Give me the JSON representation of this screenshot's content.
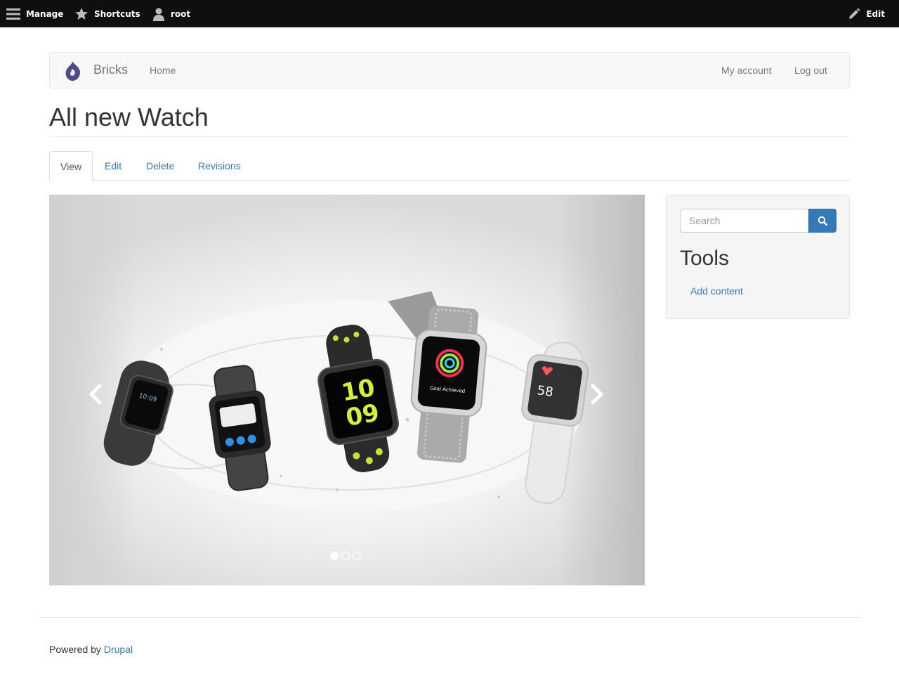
{
  "toolbar": {
    "manage_label": "Manage",
    "shortcuts_label": "Shortcuts",
    "user_label": "root",
    "edit_label": "Edit"
  },
  "navbar": {
    "brand": "Bricks",
    "home": "Home",
    "my_account": "My account",
    "log_out": "Log out"
  },
  "page": {
    "title": "All new Watch"
  },
  "tabs": [
    {
      "label": "View",
      "active": true
    },
    {
      "label": "Edit",
      "active": false
    },
    {
      "label": "Delete",
      "active": false
    },
    {
      "label": "Revisions",
      "active": false
    }
  ],
  "carousel": {
    "slide_count": 3,
    "active_slide": 1,
    "watch_texts": {
      "w1_time": "10:09",
      "w3_big1": "10",
      "w3_big2": "09",
      "w4_caption": "Goal Achieved",
      "w5_number": "58"
    }
  },
  "sidebar": {
    "search_placeholder": "Search",
    "tools_title": "Tools",
    "add_content": "Add content"
  },
  "footer": {
    "powered_by": "Powered by ",
    "drupal": "Drupal"
  },
  "colors": {
    "link": "#337ab7",
    "toolbar_bg": "#0f0f0f",
    "logo": "#4b4a8a"
  }
}
